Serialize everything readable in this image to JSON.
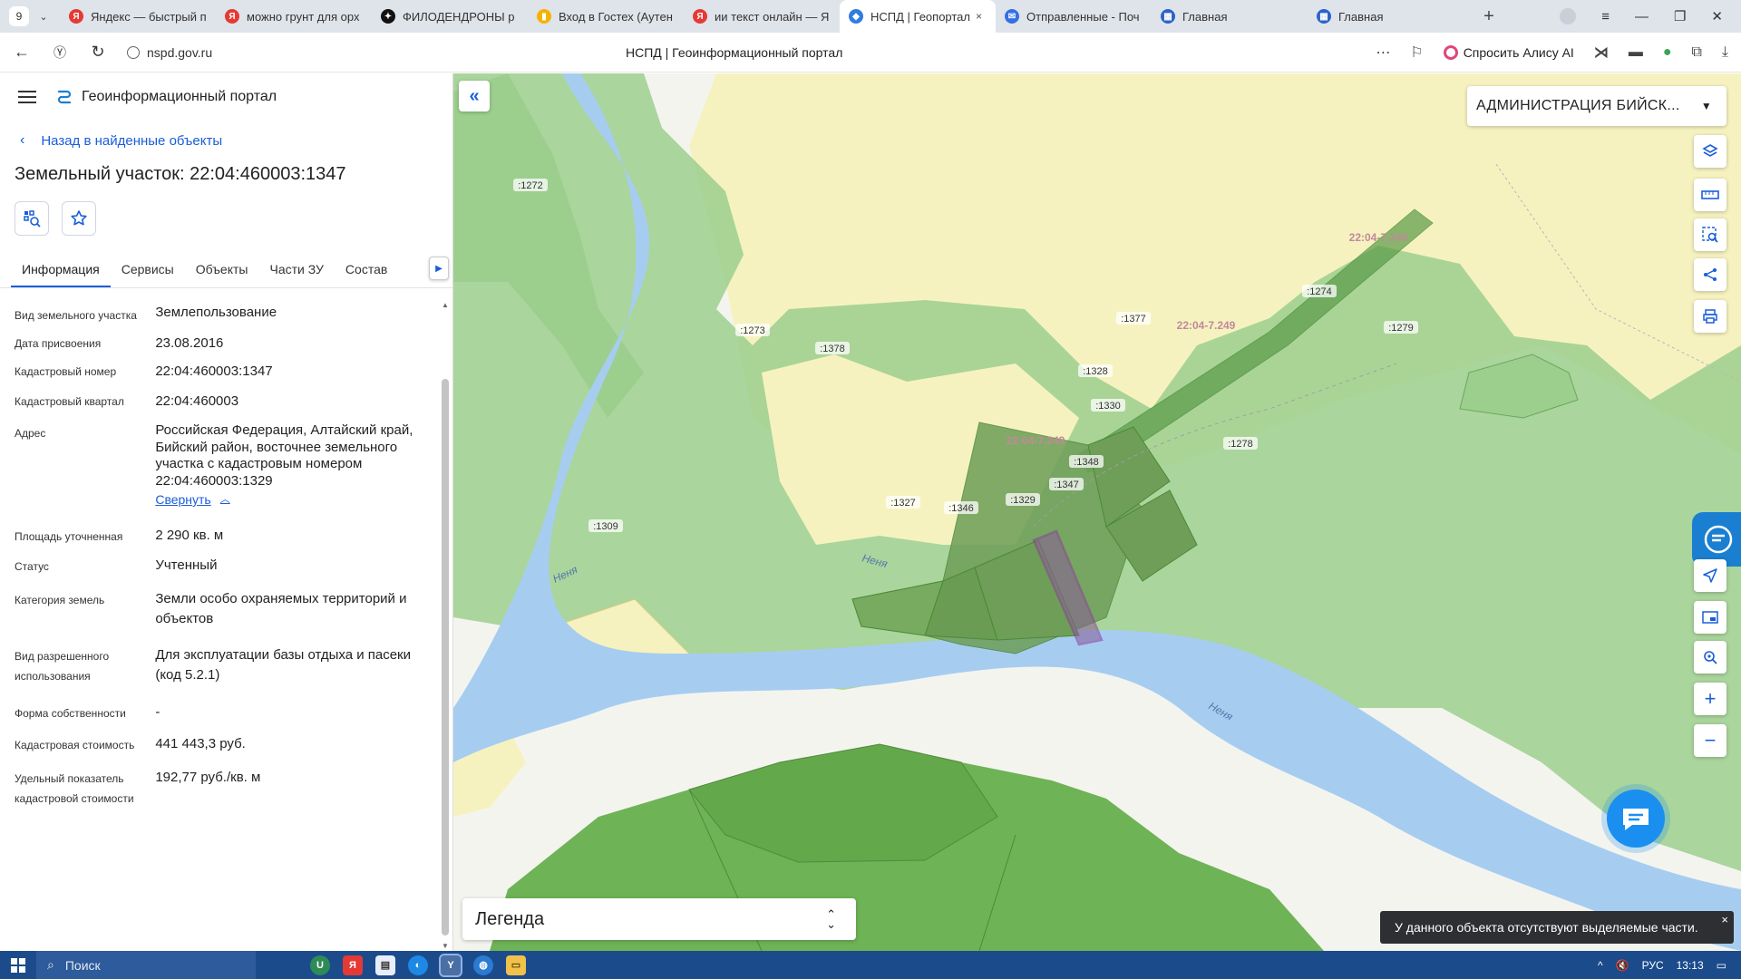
{
  "browser": {
    "tab_count": "9",
    "tabs": [
      {
        "label": "Яндекс — быстрый п",
        "color": "#e53935",
        "glyph": "Я"
      },
      {
        "label": "можно грунт для орх",
        "color": "#e53935",
        "glyph": "Я"
      },
      {
        "label": "ФИЛОДЕНДРОНЫ р",
        "color": "#111111",
        "glyph": "✦"
      },
      {
        "label": "Вход в Гостех (Аутен",
        "color": "#f2b400",
        "glyph": "▮"
      },
      {
        "label": "ии текст онлайн — Я",
        "color": "#e53935",
        "glyph": "Я"
      },
      {
        "label": "НСПД | Геопортал",
        "color": "#2f7de0",
        "glyph": "◆"
      },
      {
        "label": "Отправленные - Поч",
        "color": "#3470e4",
        "glyph": "✉"
      },
      {
        "label": "Главная",
        "color": "#2b63c9",
        "glyph": "▦"
      },
      {
        "label": "Главная",
        "color": "#2b63c9",
        "glyph": "▦"
      }
    ],
    "active_tab_close": "×",
    "url": "nspd.gov.ru",
    "page_title": "НСПД | Геоинформационный портал",
    "alice_label": "Спросить Алису AI"
  },
  "panel": {
    "portal_name": "Геоинформационный портал",
    "back_label": "Назад в найденные объекты",
    "object_title": "Земельный участок: 22:04:460003:1347",
    "tabs": [
      "Информация",
      "Сервисы",
      "Объекты",
      "Части ЗУ",
      "Состав"
    ],
    "collapse_label": "Свернуть",
    "properties": [
      {
        "key": "Вид земельного участка",
        "value": "Землепользование"
      },
      {
        "key": "Дата присвоения",
        "value": "23.08.2016"
      },
      {
        "key": "Кадастровый номер",
        "value": "22:04:460003:1347"
      },
      {
        "key": "Кадастровый квартал",
        "value": "22:04:460003"
      },
      {
        "key": "Адрес",
        "value": "Российская Федерация, Алтайский край, Бийский район, восточнее земельного участка с кадастровым номером 22:04:460003:1329"
      },
      {
        "key": "Площадь уточненная",
        "value": "2 290 кв. м"
      },
      {
        "key": "Статус",
        "value": "Учтенный"
      },
      {
        "key": "Категория земель",
        "value": "Земли особо охраняемых территорий и объектов"
      },
      {
        "key": "Вид разрешенного использования",
        "value": "Для эксплуатации базы отдыха и пасеки (код 5.2.1)"
      },
      {
        "key": "Форма собственности",
        "value": "-"
      },
      {
        "key": "Кадастровая стоимость",
        "value": "441 443,3 руб."
      },
      {
        "key": "Удельный показатель кадастровой стоимости",
        "value": "192,77 руб./кв. м"
      }
    ]
  },
  "map": {
    "admin_select": "АДМИНИСТРАЦИЯ БИЙСК...",
    "legend_label": "Легенда",
    "toast": "У данного объекта отсутствуют выделяемые части.",
    "parcel_labels": [
      ":1272",
      ":1273",
      ":1378",
      ":1377",
      ":1274",
      ":1279",
      ":1328",
      ":1330",
      ":1278",
      ":1348",
      ":1347",
      ":1329",
      ":1346",
      ":1327",
      ":1309"
    ],
    "zone_label": "22:04-7.249",
    "river_label": "Неня",
    "tools": [
      "layers-icon",
      "ruler-icon",
      "select-area-icon",
      "share-icon",
      "print-icon",
      "locate-icon",
      "minimap-icon",
      "search-location-icon",
      "zoom-in-icon",
      "zoom-out-icon"
    ],
    "colors": {
      "forest": "#9ccf8e",
      "field": "#f6f2c0",
      "river": "#a6cdf0",
      "selected": "#8e3a9e",
      "dark_green": "#5a9a49"
    }
  },
  "taskbar": {
    "search_placeholder": "Поиск",
    "lang": "РУС",
    "time": "13:13"
  }
}
